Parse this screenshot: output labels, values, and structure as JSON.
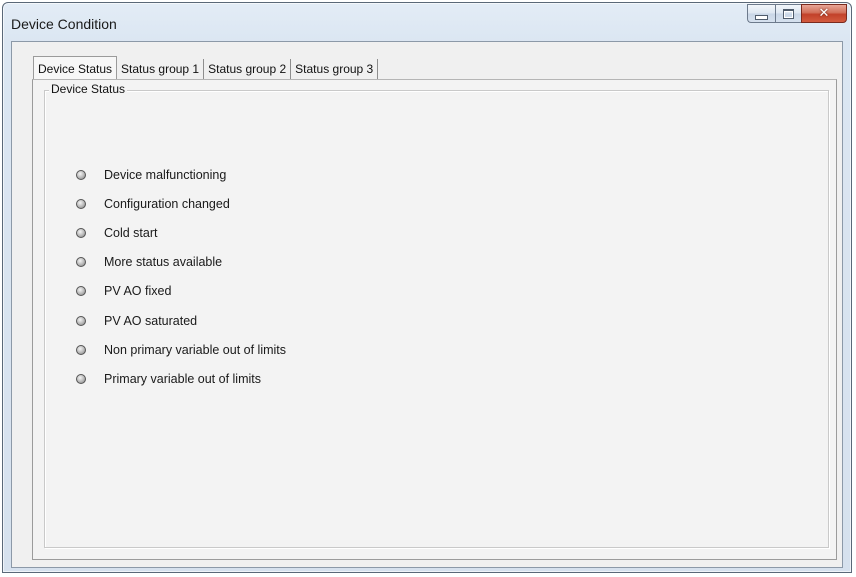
{
  "window": {
    "title": "Device Condition",
    "controls": {
      "minimize": "minimize-icon",
      "maximize": "maximize-icon",
      "close": "close-icon"
    }
  },
  "tabs": [
    {
      "label": "Device Status",
      "active": true
    },
    {
      "label": "Status group 1",
      "active": false
    },
    {
      "label": "Status group 2",
      "active": false
    },
    {
      "label": "Status group 3",
      "active": false
    }
  ],
  "group": {
    "title": "Device Status",
    "items": [
      {
        "label": "Device malfunctioning",
        "state": "off"
      },
      {
        "label": "Configuration changed",
        "state": "off"
      },
      {
        "label": "Cold start",
        "state": "off"
      },
      {
        "label": "More status available",
        "state": "off"
      },
      {
        "label": "PV AO fixed",
        "state": "off"
      },
      {
        "label": "PV AO saturated",
        "state": "off"
      },
      {
        "label": "Non primary variable out of limits",
        "state": "off"
      },
      {
        "label": "Primary variable out of limits",
        "state": "off"
      }
    ]
  },
  "colors": {
    "indicator_off": "#9a9a9a",
    "close_button": "#c2412a"
  }
}
